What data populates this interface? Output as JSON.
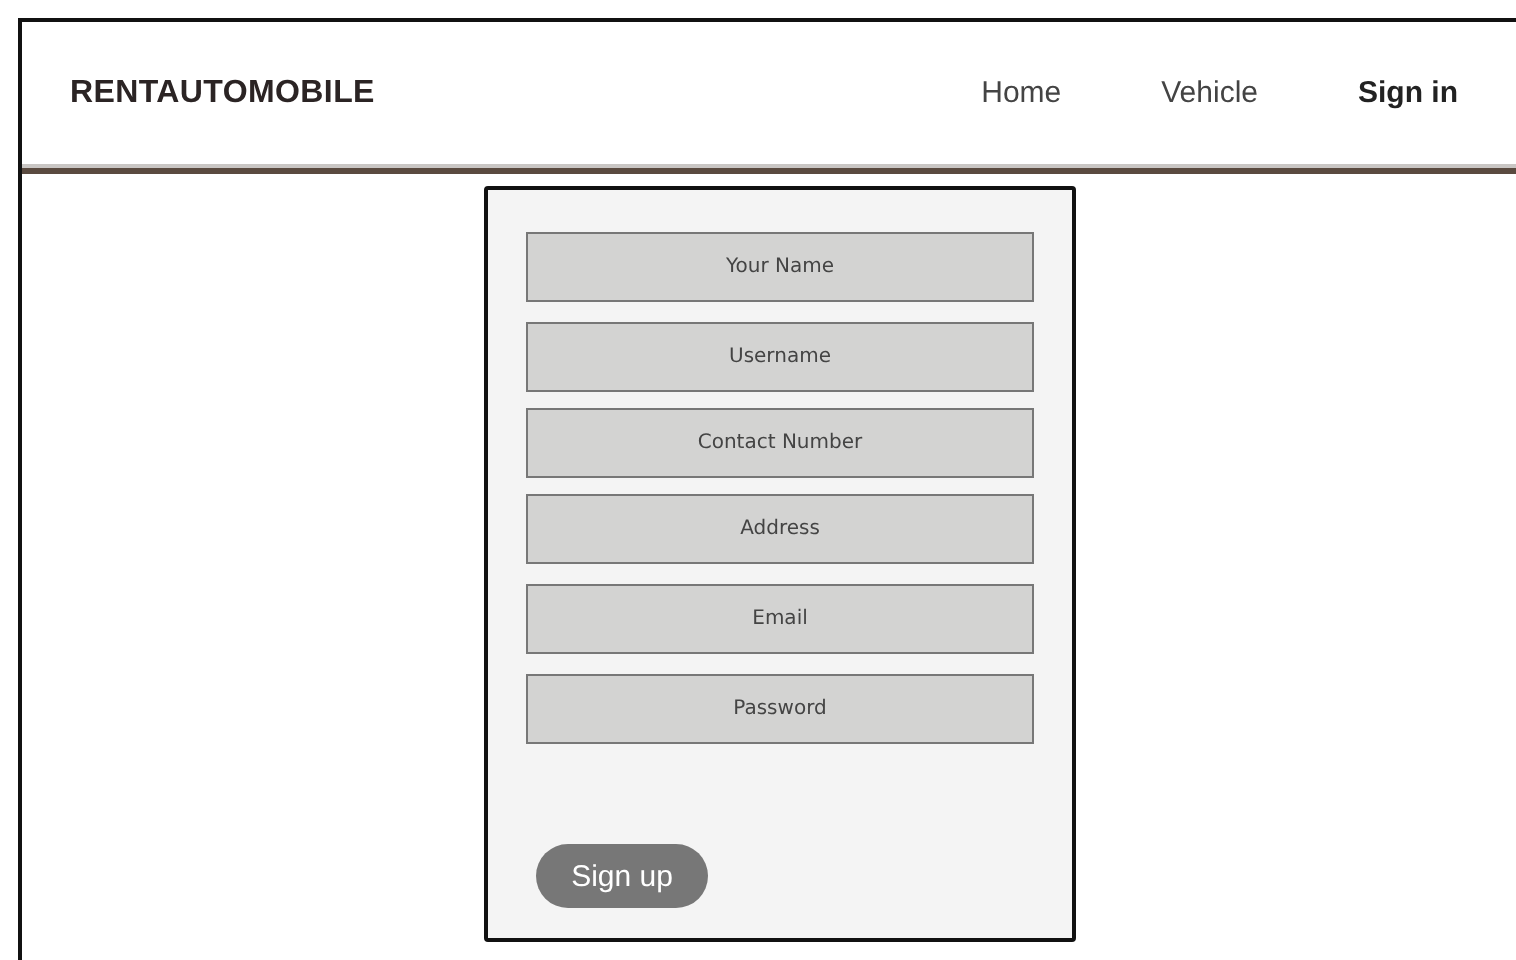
{
  "brand": "RENTAUTOMOBILE",
  "nav": [
    {
      "label": "Home",
      "selected": false
    },
    {
      "label": "Vehicle",
      "selected": false
    },
    {
      "label": "Sign in",
      "selected": true
    }
  ],
  "form": {
    "fields": [
      {
        "placeholder": "Your Name"
      },
      {
        "placeholder": "Username"
      },
      {
        "placeholder": "Contact Number"
      },
      {
        "placeholder": "Address"
      },
      {
        "placeholder": "Email"
      },
      {
        "placeholder": "Password"
      }
    ],
    "submit": "Sign up"
  }
}
